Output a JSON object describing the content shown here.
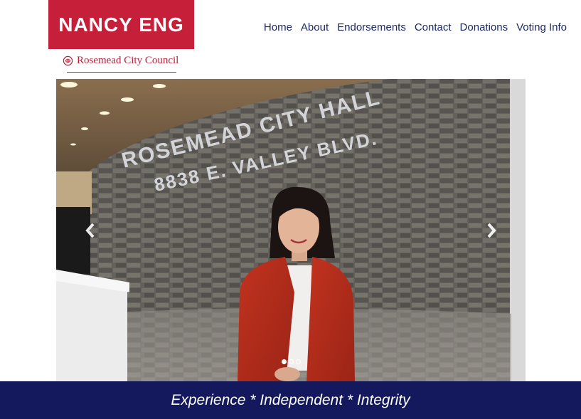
{
  "brand": {
    "name": "NANCY ENG",
    "subtitle": "Rosemead City Council",
    "logo_color": "#c51f3a"
  },
  "nav": {
    "items": [
      "Home",
      "About",
      "Endorsements",
      "Contact",
      "Donations",
      "Voting Info"
    ]
  },
  "carousel": {
    "wall_text_line1": "ROSEMEAD CITY HALL",
    "wall_text_line2": "8838 E. VALLEY BLVD.",
    "prev_icon": "chevron-left-icon",
    "next_icon": "chevron-right-icon",
    "slide_count": 3,
    "active_slide": 1
  },
  "banner": {
    "text": "Experience * Independent * Integrity",
    "color": "#13195c"
  }
}
